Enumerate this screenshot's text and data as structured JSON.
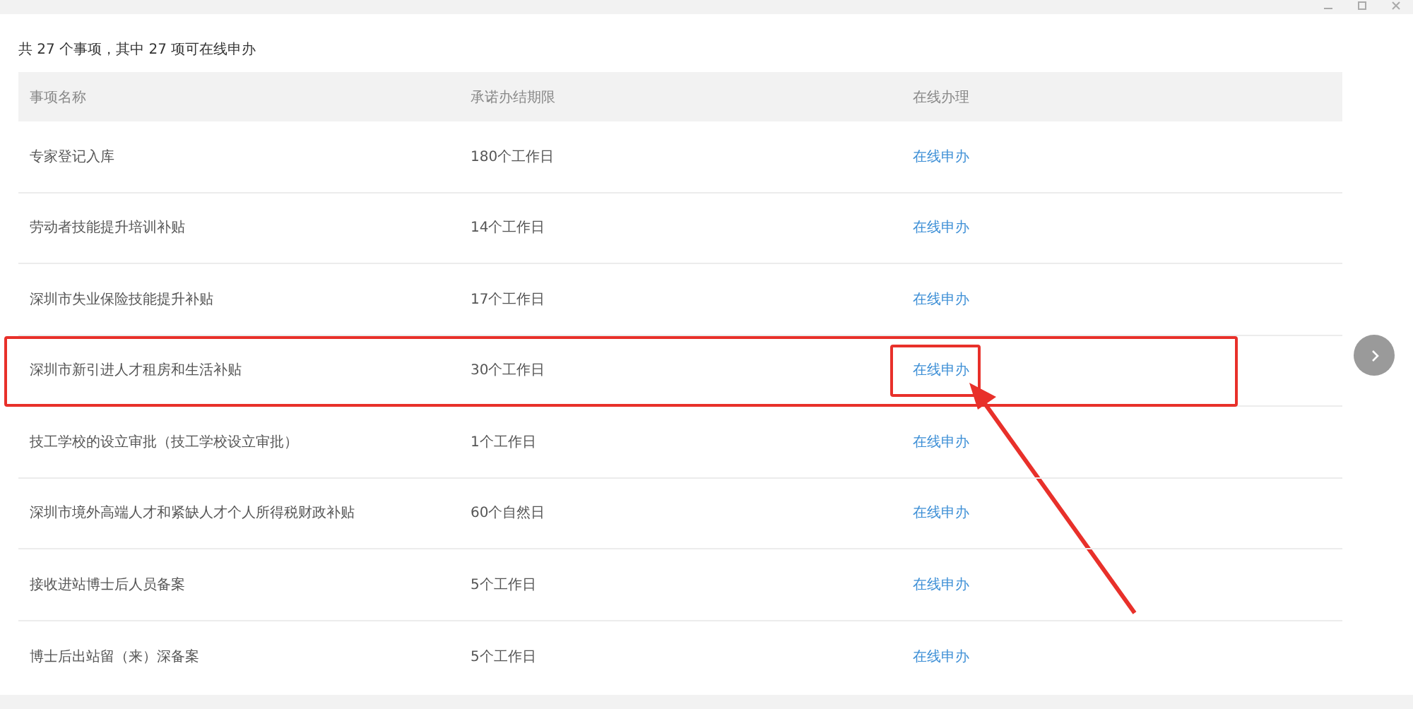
{
  "summary": "共 27 个事项，其中 27 项可在线申办",
  "table": {
    "columns": [
      "事项名称",
      "承诺办结期限",
      "在线办理"
    ],
    "rows": [
      {
        "name": "专家登记入库",
        "deadline": "180个工作日",
        "action": "在线申办",
        "highlighted": false
      },
      {
        "name": "劳动者技能提升培训补贴",
        "deadline": "14个工作日",
        "action": "在线申办",
        "highlighted": false
      },
      {
        "name": "深圳市失业保险技能提升补贴",
        "deadline": "17个工作日",
        "action": "在线申办",
        "highlighted": false
      },
      {
        "name": "深圳市新引进人才租房和生活补贴",
        "deadline": "30个工作日",
        "action": "在线申办",
        "highlighted": true
      },
      {
        "name": "技工学校的设立审批（技工学校设立审批）",
        "deadline": "1个工作日",
        "action": "在线申办",
        "highlighted": false
      },
      {
        "name": "深圳市境外高端人才和紧缺人才个人所得税财政补贴",
        "deadline": "60个自然日",
        "action": "在线申办",
        "highlighted": false
      },
      {
        "name": "接收进站博士后人员备案",
        "deadline": "5个工作日",
        "action": "在线申办",
        "highlighted": false
      },
      {
        "name": "博士后出站留（来）深备案",
        "deadline": "5个工作日",
        "action": "在线申办",
        "highlighted": false
      }
    ]
  }
}
